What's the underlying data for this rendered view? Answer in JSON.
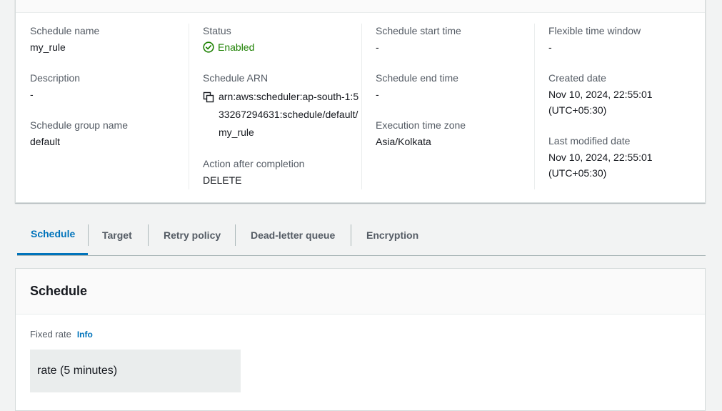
{
  "details": {
    "schedule_name": {
      "label": "Schedule name",
      "value": "my_rule"
    },
    "description": {
      "label": "Description",
      "value": "-"
    },
    "schedule_group_name": {
      "label": "Schedule group name",
      "value": "default"
    },
    "status": {
      "label": "Status",
      "value": "Enabled",
      "icon": "check-circle-icon",
      "color": "#1d8102"
    },
    "schedule_arn": {
      "label": "Schedule ARN",
      "value": "arn:aws:scheduler:ap-south-1:533267294631:schedule/default/my_rule",
      "icon": "copy-icon"
    },
    "action_after_completion": {
      "label": "Action after completion",
      "value": "DELETE"
    },
    "schedule_start_time": {
      "label": "Schedule start time",
      "value": "-"
    },
    "schedule_end_time": {
      "label": "Schedule end time",
      "value": "-"
    },
    "execution_time_zone": {
      "label": "Execution time zone",
      "value": "Asia/Kolkata"
    },
    "flexible_time_window": {
      "label": "Flexible time window",
      "value": "-"
    },
    "created_date": {
      "label": "Created date",
      "value": "Nov 10, 2024, 22:55:01 (UTC+05:30)"
    },
    "last_modified_date": {
      "label": "Last modified date",
      "value": "Nov 10, 2024, 22:55:01 (UTC+05:30)"
    }
  },
  "tabs": [
    {
      "label": "Schedule",
      "active": true
    },
    {
      "label": "Target",
      "active": false
    },
    {
      "label": "Retry policy",
      "active": false
    },
    {
      "label": "Dead-letter queue",
      "active": false
    },
    {
      "label": "Encryption",
      "active": false
    }
  ],
  "schedule_panel": {
    "title": "Schedule",
    "field_label": "Fixed rate",
    "info_link": "Info",
    "value": "rate (5 minutes)"
  },
  "colors": {
    "accent": "#0073bb",
    "success": "#1d8102"
  }
}
